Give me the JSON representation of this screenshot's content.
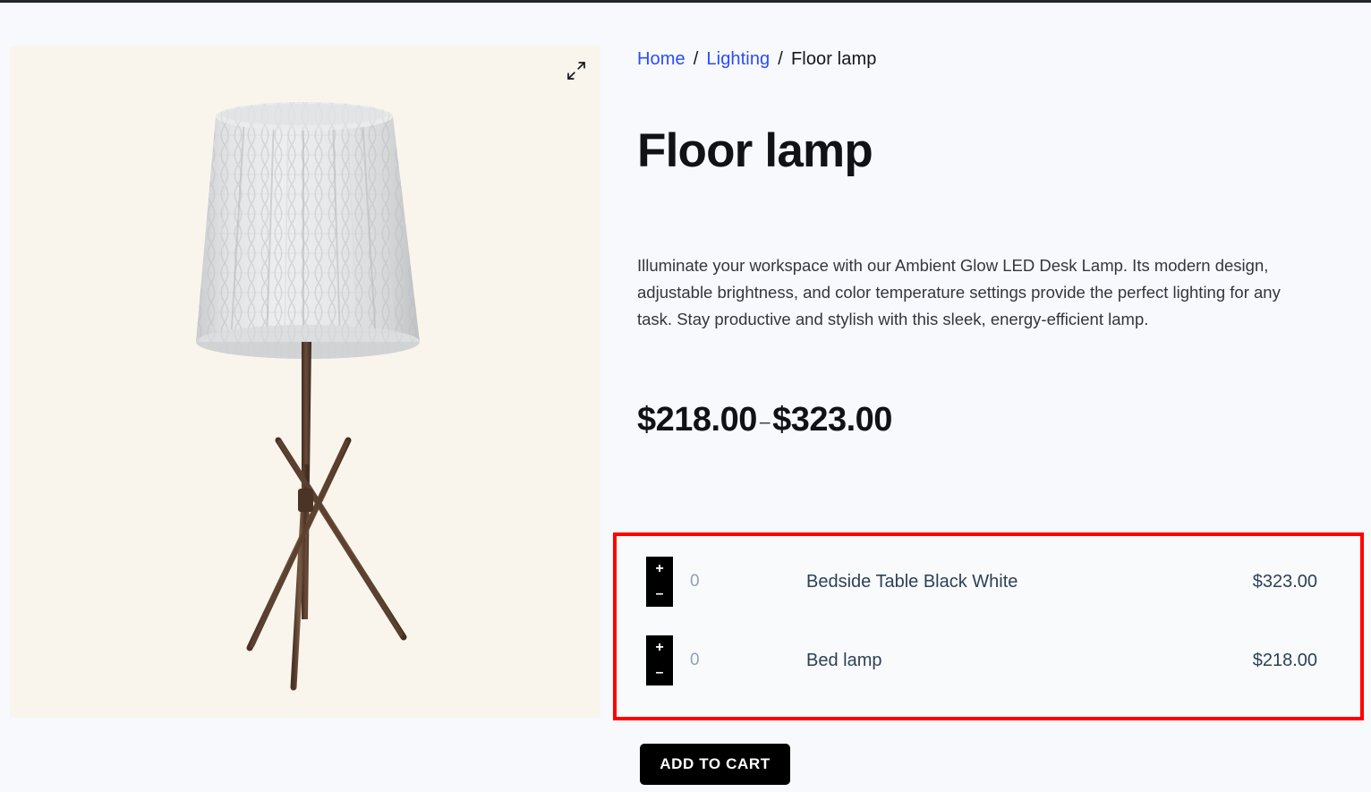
{
  "breadcrumb": {
    "items": [
      {
        "label": "Home",
        "type": "link"
      },
      {
        "label": "Lighting",
        "type": "link"
      },
      {
        "label": "Floor lamp",
        "type": "current"
      }
    ],
    "separator": "/"
  },
  "product": {
    "title": "Floor lamp",
    "description": "Illuminate your workspace with our Ambient Glow LED Desk Lamp. Its modern design, adjustable brightness, and color temperature settings provide the perfect lighting for any task. Stay productive and stylish with this sleek, energy-efficient lamp.",
    "price_min": "$218.00",
    "price_separator": "–",
    "price_max": "$323.00"
  },
  "gallery": {
    "expand_icon": "expand-arrows-icon",
    "background_color": "#faf5ec",
    "image_alt": "Floor lamp with knitted grey shade and wooden tripod base"
  },
  "variants": {
    "highlight_color": "#fe0000",
    "increment_label": "+",
    "decrement_label": "–",
    "rows": [
      {
        "quantity": "0",
        "name": "Bedside Table Black White",
        "price": "$323.00"
      },
      {
        "quantity": "0",
        "name": "Bed lamp",
        "price": "$218.00"
      }
    ]
  },
  "actions": {
    "add_to_cart_label": "ADD TO CART"
  },
  "colors": {
    "page_background": "#f7f9fc",
    "link": "#2b4bff",
    "text": "#101216",
    "muted_text": "#90a2b4",
    "variant_text": "#2e4156",
    "button_background": "#000000"
  }
}
